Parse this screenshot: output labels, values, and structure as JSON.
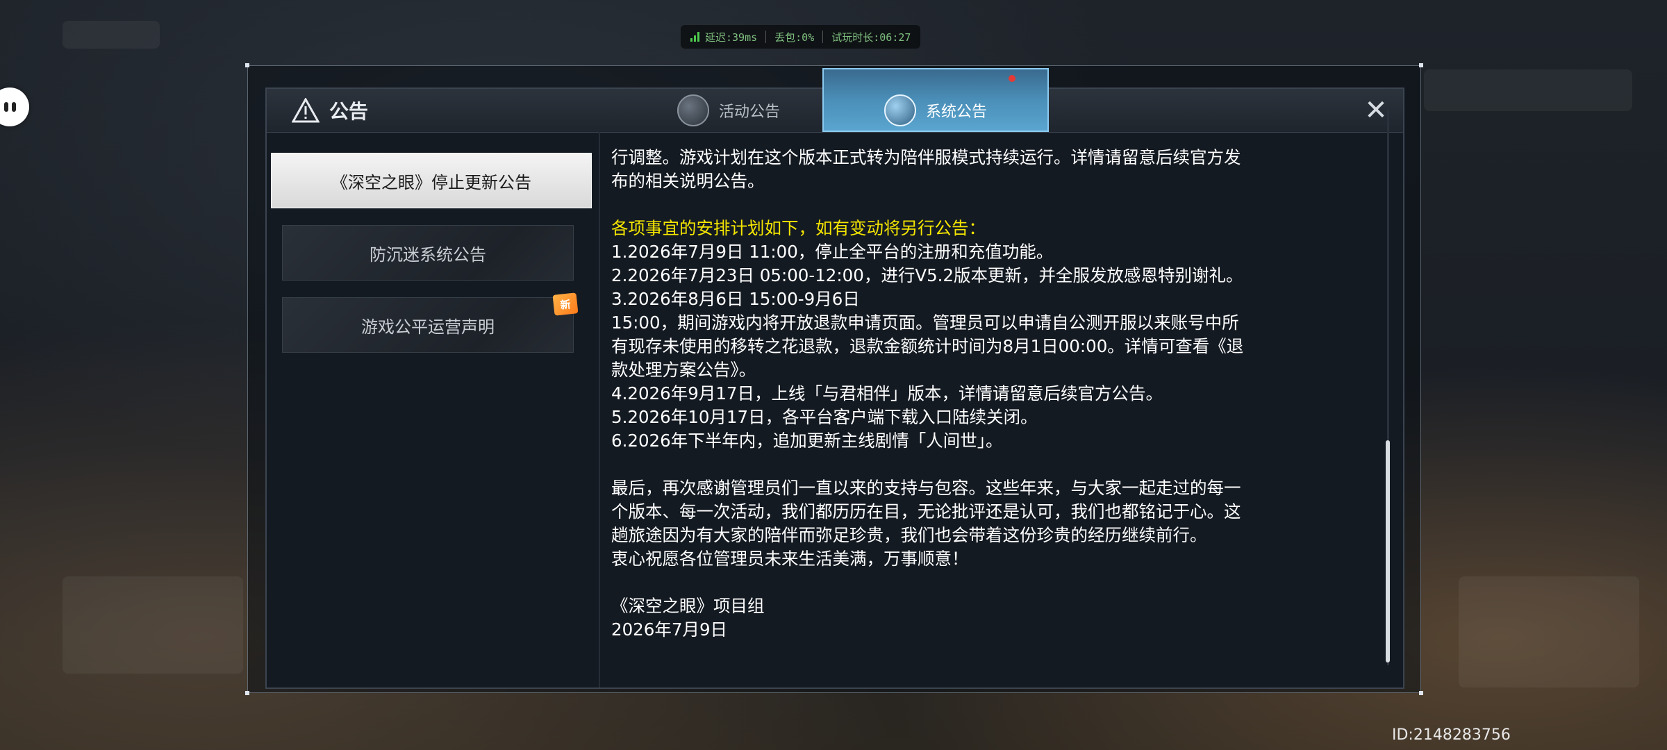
{
  "status": {
    "latency": "延迟:39ms",
    "packet_loss": "丢包:0%",
    "trial_time": "试玩时长:06:27"
  },
  "dialog": {
    "title": "公告",
    "tabs": [
      {
        "label": "活动公告",
        "active": false
      },
      {
        "label": "系统公告",
        "active": true
      }
    ]
  },
  "sidebar": {
    "items": [
      {
        "label": "《深空之眼》停止更新公告",
        "active": true
      },
      {
        "label": "防沉迷系统公告",
        "active": false
      },
      {
        "label": "游戏公平运营声明",
        "active": false,
        "badge": "新"
      }
    ]
  },
  "content": {
    "lines": [
      "行调整。游戏计划在这个版本正式转为陪伴服模式持续运行。详情请留意后续官方发",
      "布的相关说明公告。",
      "",
      "各项事宜的安排计划如下，如有变动将另行公告：",
      "1.2026年7月9日 11:00，停止全平台的注册和充值功能。",
      "2.2026年7月23日 05:00-12:00，进行V5.2版本更新，并全服发放感恩特别谢礼。",
      "3.2026年8月6日 15:00-9月6日",
      "15:00，期间游戏内将开放退款申请页面。管理员可以申请自公测开服以来账号中所",
      "有现存未使用的移转之花退款，退款金额统计时间为8月1日00:00。详情可查看《退",
      "款处理方案公告》。",
      "4.2026年9月17日，上线「与君相伴」版本，详情请留意后续官方公告。",
      "5.2026年10月17日，各平台客户端下载入口陆续关闭。",
      "6.2026年下半年内，追加更新主线剧情「人间世」。",
      "",
      "最后，再次感谢管理员们一直以来的支持与包容。这些年来，与大家一起走过的每一",
      "个版本、每一次活动，我们都历历在目，无论批评还是认可，我们也都铭记于心。这",
      "趟旅途因为有大家的陪伴而弥足珍贵，我们也会带着这份珍贵的经历继续前行。",
      "衷心祝愿各位管理员未来生活美满，万事顺意！",
      "",
      "《深空之眼》项目组",
      "2026年7月9日"
    ],
    "highlight_color": "#f5e600"
  },
  "footer": {
    "id": "ID:2148283756"
  }
}
